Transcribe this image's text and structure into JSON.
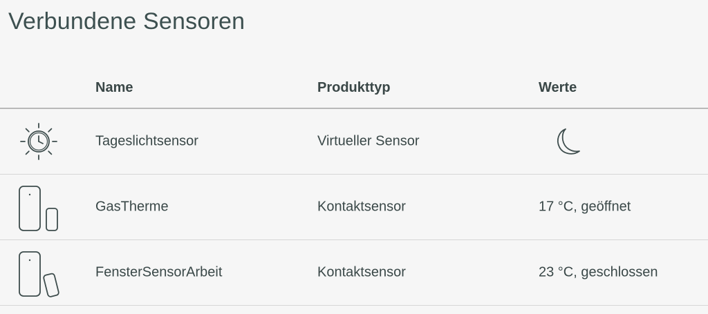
{
  "page": {
    "title": "Verbundene Sensoren"
  },
  "table": {
    "columns": {
      "name": "Name",
      "type": "Produkttyp",
      "values": "Werte"
    },
    "rows": [
      {
        "icon": "daylight-clock-icon",
        "name": "Tageslichtsensor",
        "type": "Virtueller Sensor",
        "value": "",
        "value_icon": "moon-icon"
      },
      {
        "icon": "contact-sensor-closed-icon",
        "name": "GasTherme",
        "type": "Kontaktsensor",
        "value": "17 °C, geöffnet"
      },
      {
        "icon": "contact-sensor-open-icon",
        "name": "FensterSensorArbeit",
        "type": "Kontaktsensor",
        "value": "23 °C, geschlossen"
      }
    ]
  },
  "colors": {
    "text": "#3a4848",
    "divider": "#d6d6d6",
    "header_divider": "#b9b9b9",
    "background": "#f6f6f6"
  }
}
